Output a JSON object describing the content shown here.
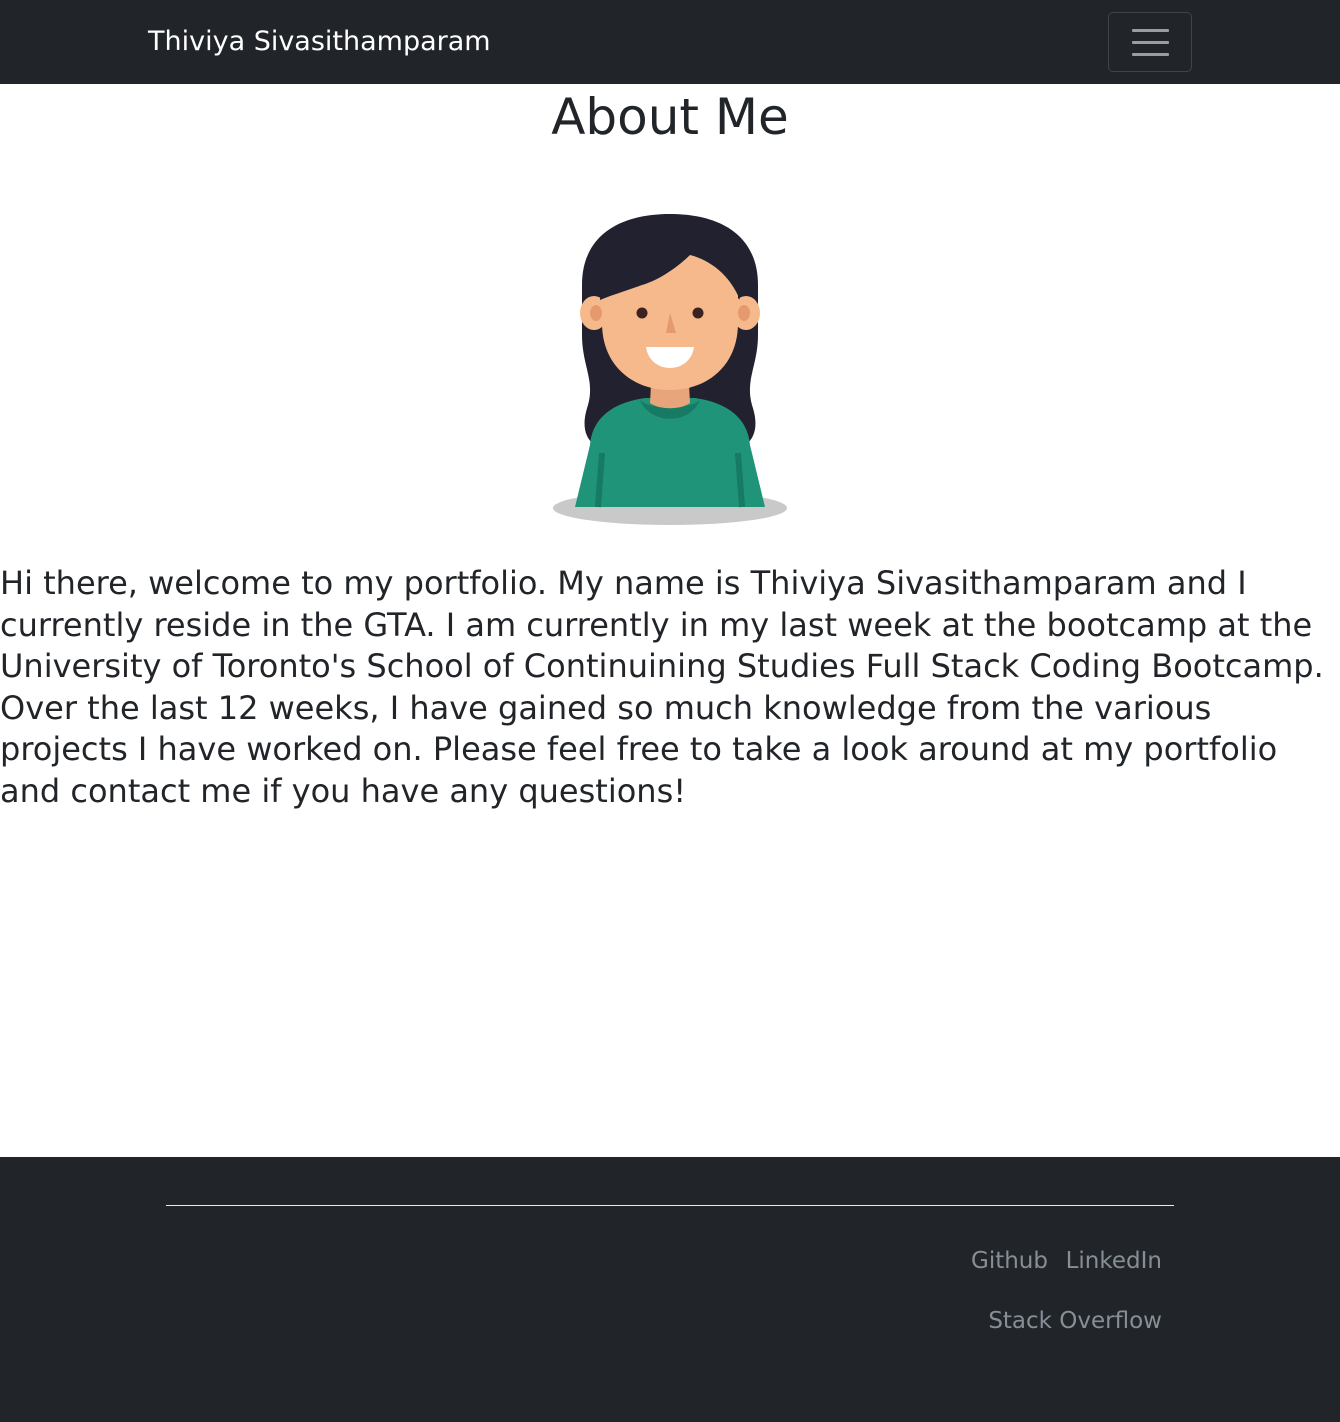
{
  "navbar": {
    "brand": "Thiviya Sivasithamparam",
    "toggler_icon": "hamburger-menu-icon"
  },
  "main": {
    "title": "About Me",
    "avatar_icon": "cartoon-girl-avatar",
    "intro": "Hi there, welcome to my portfolio. My name is Thiviya Sivasithamparam and I currently reside in the GTA. I am currently in my last week at the bootcamp at the University of Toronto's School of Continuining Studies Full Stack Coding Bootcamp. Over the last 12 weeks, I have gained so much knowledge from the various projects I have worked on. Please feel free to take a look around at my portfolio and contact me if you have any questions!"
  },
  "footer": {
    "links": [
      {
        "label": "Github"
      },
      {
        "label": "LinkedIn"
      },
      {
        "label": "Stack Overflow"
      }
    ]
  },
  "colors": {
    "nav_bg": "#212529",
    "footer_link": "#868e96",
    "shirt": "#1f9479",
    "hair": "#22212f",
    "skin": "#f5b98c"
  }
}
